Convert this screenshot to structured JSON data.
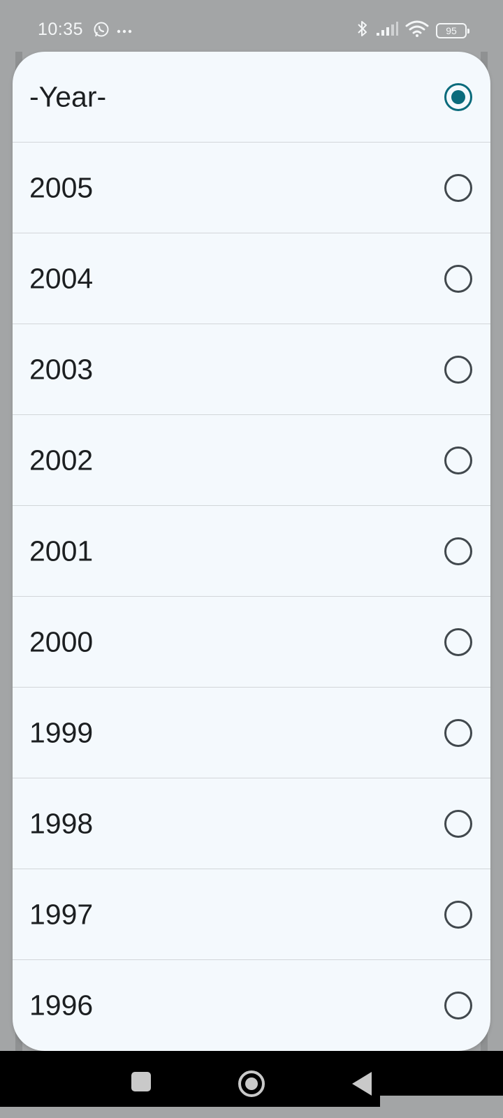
{
  "status_bar": {
    "time": "10:35",
    "left_icons": [
      "whatsapp-icon",
      "more-dots-icon"
    ],
    "right_icons": [
      "bluetooth-icon",
      "signal-icon",
      "wifi-icon"
    ],
    "battery": "95"
  },
  "year_picker": {
    "selected": "-Year-",
    "options": [
      {
        "label": "-Year-",
        "checked": true
      },
      {
        "label": "2005",
        "checked": false
      },
      {
        "label": "2004",
        "checked": false
      },
      {
        "label": "2003",
        "checked": false
      },
      {
        "label": "2002",
        "checked": false
      },
      {
        "label": "2001",
        "checked": false
      },
      {
        "label": "2000",
        "checked": false
      },
      {
        "label": "1999",
        "checked": false
      },
      {
        "label": "1998",
        "checked": false
      },
      {
        "label": "1997",
        "checked": false
      },
      {
        "label": "1996",
        "checked": false
      }
    ]
  },
  "nav_bar": {
    "buttons": [
      "recents-icon",
      "home-icon",
      "back-icon"
    ]
  },
  "colors": {
    "accent": "#0a6b7c",
    "dialog_bg": "#f4f9fd",
    "scrim": "#a3a5a6"
  }
}
